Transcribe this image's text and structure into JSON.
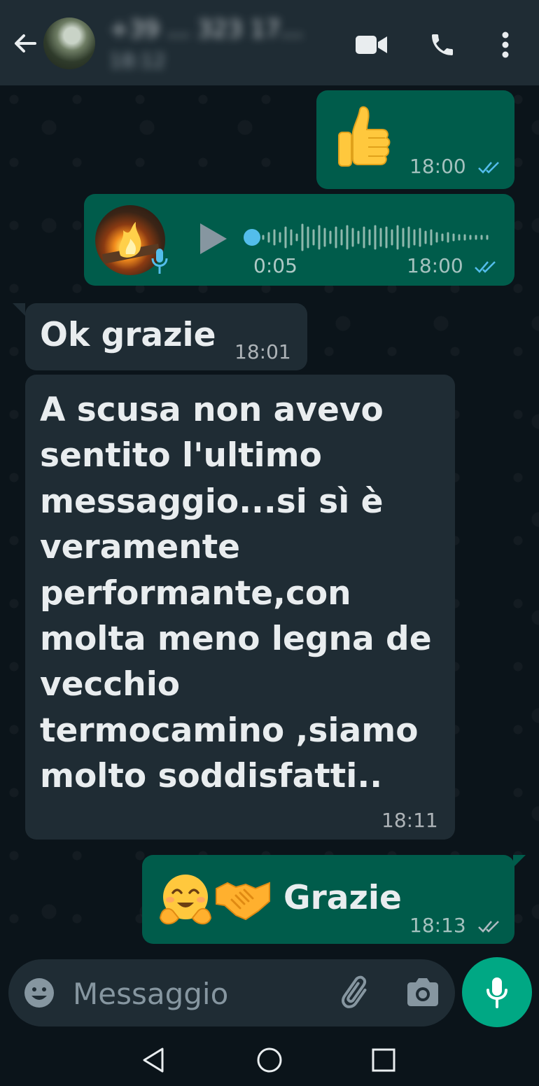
{
  "header": {
    "contact_name": "+39 ... 323 17...",
    "contact_status": "18:12"
  },
  "messages": [
    {
      "id": "m1",
      "direction": "outgoing",
      "type": "emoji",
      "emoji": "thumbs-up",
      "time": "18:00",
      "status": "read"
    },
    {
      "id": "m2",
      "direction": "outgoing",
      "type": "voice",
      "duration": "0:05",
      "time": "18:00",
      "status": "read"
    },
    {
      "id": "m3",
      "direction": "incoming",
      "type": "text",
      "text": "Ok grazie",
      "time": "18:01"
    },
    {
      "id": "m4",
      "direction": "incoming",
      "type": "text",
      "text": "A scusa non avevo\nsentito l'ultimo\nmessaggio...si sì è\nveramente\nperformante,con\nmolta meno legna de\nvecchio\ntermocamino ,siamo\nmolto soddisfatti..",
      "time": "18:11"
    },
    {
      "id": "m5",
      "direction": "outgoing",
      "type": "text",
      "emojis": [
        "hugging-face",
        "handshake"
      ],
      "text": "Grazie",
      "time": "18:13",
      "status": "delivered"
    }
  ],
  "composer": {
    "placeholder": "Messaggio"
  },
  "icons": {
    "back": "arrow-left-icon",
    "video": "video-camera-icon",
    "call": "phone-icon",
    "menu": "more-vertical-icon",
    "emoji": "smiley-icon",
    "attach": "paperclip-icon",
    "camera": "camera-icon",
    "mic": "microphone-icon"
  },
  "colors": {
    "header_bg": "#1f2c34",
    "chat_bg": "#0b141a",
    "outgoing_bubble": "#005c4b",
    "incoming_bubble": "#1f2c34",
    "read_ticks": "#53bdeb",
    "accent": "#00a884"
  }
}
